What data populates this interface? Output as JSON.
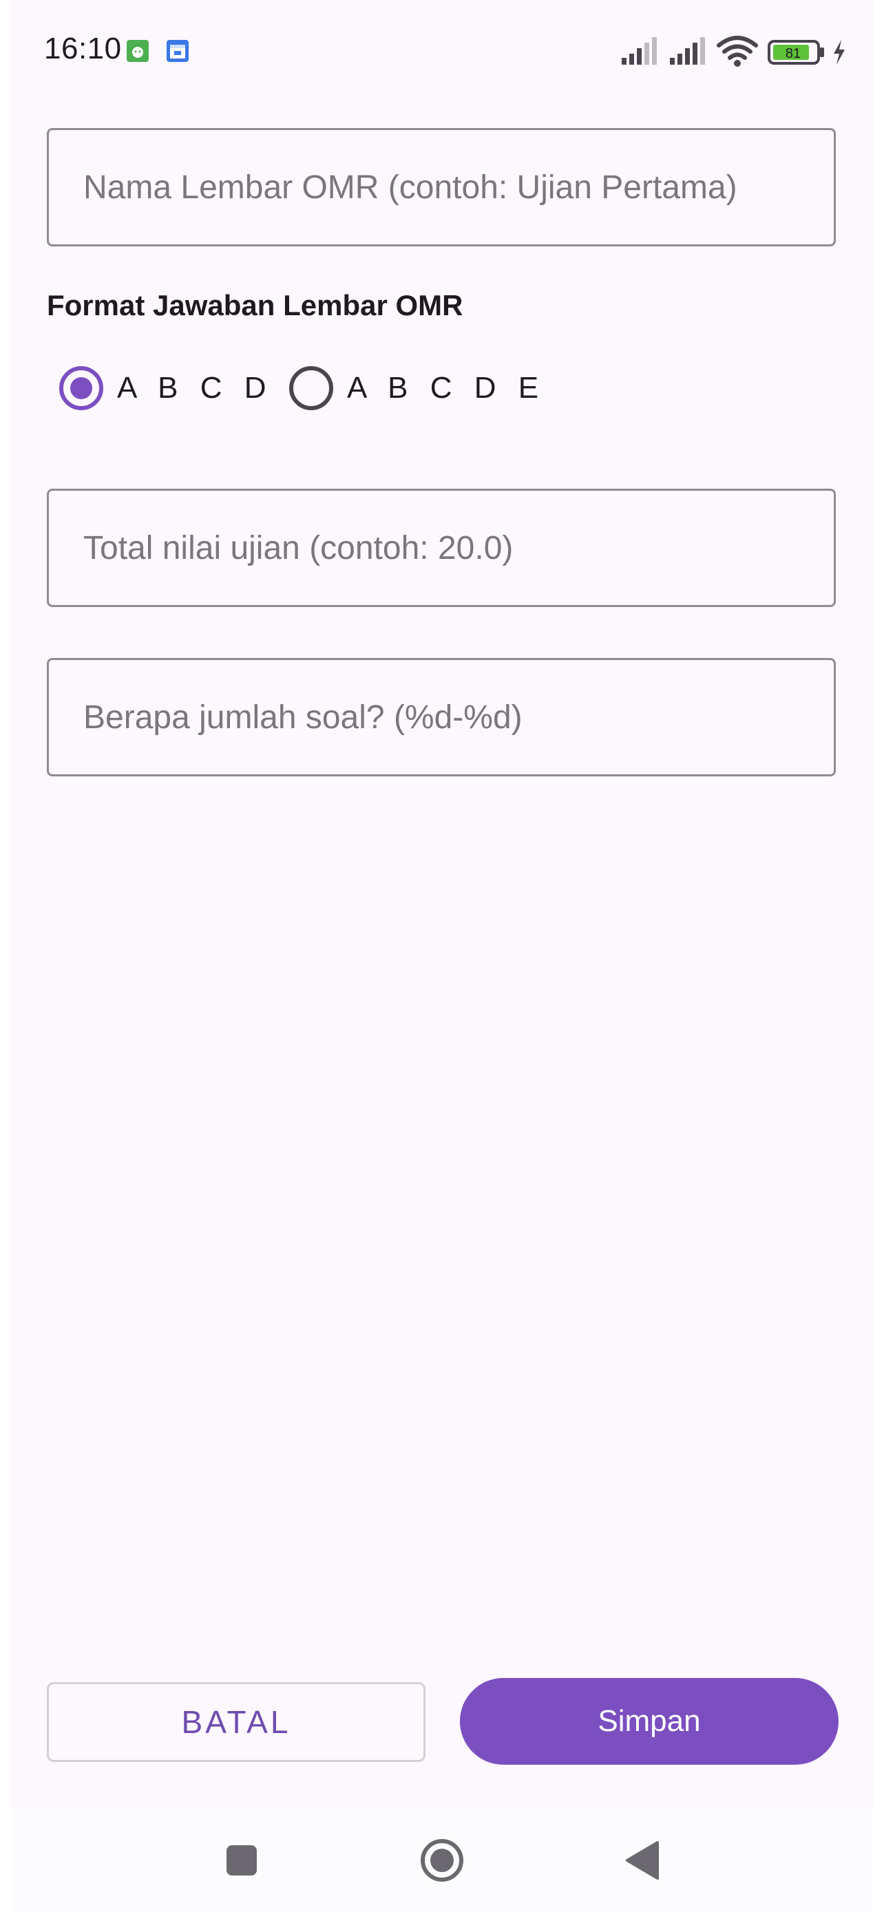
{
  "status_bar": {
    "time": "16:10",
    "battery_level": "81",
    "notification_icons": [
      "android-icon",
      "calendar-icon"
    ],
    "system_icons": [
      "signal-icon",
      "signal-icon",
      "wifi-icon",
      "battery-icon",
      "charging-icon"
    ]
  },
  "form": {
    "sheet_name": {
      "placeholder": "Nama Lembar OMR (contoh: Ujian Pertama)",
      "value": ""
    },
    "format_label": "Format Jawaban Lembar OMR",
    "format_options": [
      {
        "label": "A B C D",
        "selected": true
      },
      {
        "label": "A B C D E",
        "selected": false
      }
    ],
    "total_score": {
      "placeholder": "Total nilai ujian (contoh: 20.0)",
      "value": ""
    },
    "question_count": {
      "placeholder": "Berapa jumlah soal? (%d-%d)",
      "value": ""
    }
  },
  "actions": {
    "cancel_label": "BATAL",
    "save_label": "Simpan"
  },
  "colors": {
    "accent": "#7b4fc0",
    "background": "#fdf7fe",
    "outline": "#8e8b93"
  },
  "nav_bar": {
    "icons": [
      "recents-icon",
      "home-icon",
      "back-icon"
    ]
  }
}
